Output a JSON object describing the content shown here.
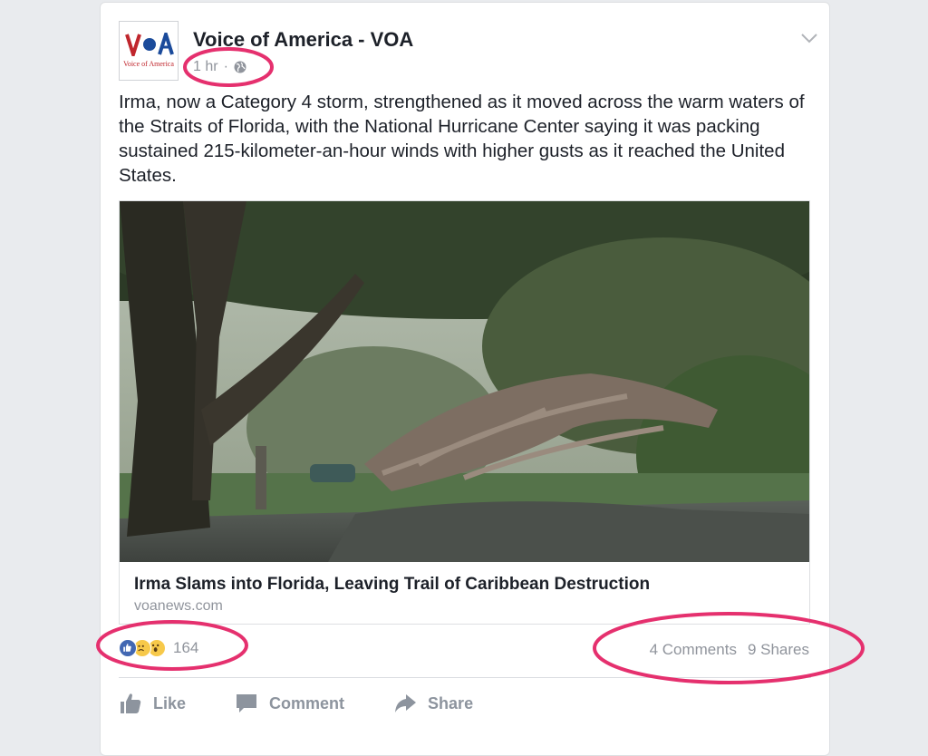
{
  "post": {
    "page_name": "Voice of America - VOA",
    "logo": {
      "sub_text": "Voice of America"
    },
    "timestamp": "1 hr",
    "separator": "·",
    "privacy_icon": "globe-icon",
    "menu_icon": "chevron-down-icon",
    "text": "Irma, now a Category 4 storm, strengthened as it moved across the warm waters of the Straits of Florida, with the National Hurricane Center saying it was packing sustained 215-kilometer-an-hour winds with higher gusts as it reached the United States."
  },
  "link": {
    "title": "Irma Slams into Florida, Leaving Trail of Caribbean Destruction",
    "domain": "voanews.com"
  },
  "stats": {
    "reaction_icons": [
      "like-icon",
      "sad-icon",
      "wow-icon"
    ],
    "reaction_count": "164",
    "comments": "4 Comments",
    "shares": "9 Shares"
  },
  "actions": {
    "like": "Like",
    "comment": "Comment",
    "share": "Share"
  },
  "colors": {
    "page_bg": "#e9ebee",
    "text": "#1d2129",
    "muted": "#90949c",
    "brand_red": "#c0262d",
    "brand_blue": "#1b4b9b",
    "annotation": "#e5306e"
  }
}
